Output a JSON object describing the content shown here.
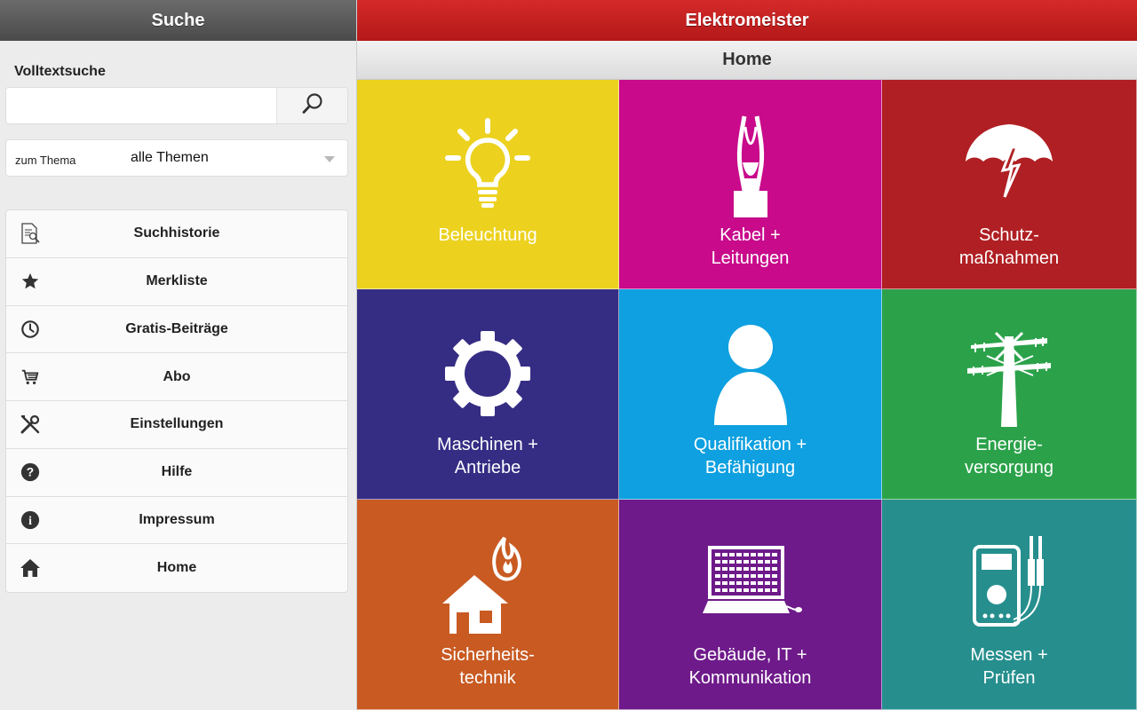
{
  "left": {
    "title": "Suche",
    "fulltext_title": "Volltextsuche",
    "search": {
      "value": "",
      "placeholder": ""
    },
    "topic_label": "zum Thema",
    "topic_value": "alle Themen",
    "menu": [
      {
        "label": "Suchhistorie",
        "icon": "history-document-icon"
      },
      {
        "label": "Merkliste",
        "icon": "star-icon"
      },
      {
        "label": "Gratis-Beiträge",
        "icon": "clock-icon"
      },
      {
        "label": "Abo",
        "icon": "cart-icon"
      },
      {
        "label": "Einstellungen",
        "icon": "tools-icon"
      },
      {
        "label": "Hilfe",
        "icon": "help-icon"
      },
      {
        "label": "Impressum",
        "icon": "info-icon"
      },
      {
        "label": "Home",
        "icon": "home-icon"
      }
    ]
  },
  "app": {
    "title": "Elektromeister",
    "page_title": "Home"
  },
  "tiles": [
    {
      "label": "Beleuchtung",
      "color": "#ecd21f",
      "icon": "lightbulb-icon"
    },
    {
      "label": "Kabel +\nLeitungen",
      "color": "#c80a8b",
      "icon": "cable-icon"
    },
    {
      "label": "Schutz-\nmaßnahmen",
      "color": "#b01f23",
      "icon": "umbrella-lightning-icon"
    },
    {
      "label": "Maschinen +\nAntriebe",
      "color": "#352d84",
      "icon": "gear-icon"
    },
    {
      "label": "Qualifikation +\nBefähigung",
      "color": "#0ea0e0",
      "icon": "person-icon"
    },
    {
      "label": "Energie-\nversorgung",
      "color": "#2ba24a",
      "icon": "power-pylon-icon"
    },
    {
      "label": "Sicherheits-\ntechnik",
      "color": "#c85a22",
      "icon": "house-fire-icon"
    },
    {
      "label": "Gebäude, IT +\nKommunikation",
      "color": "#6e1a8a",
      "icon": "laptop-icon"
    },
    {
      "label": "Messen +\nPrüfen",
      "color": "#268f8e",
      "icon": "multimeter-icon"
    }
  ]
}
